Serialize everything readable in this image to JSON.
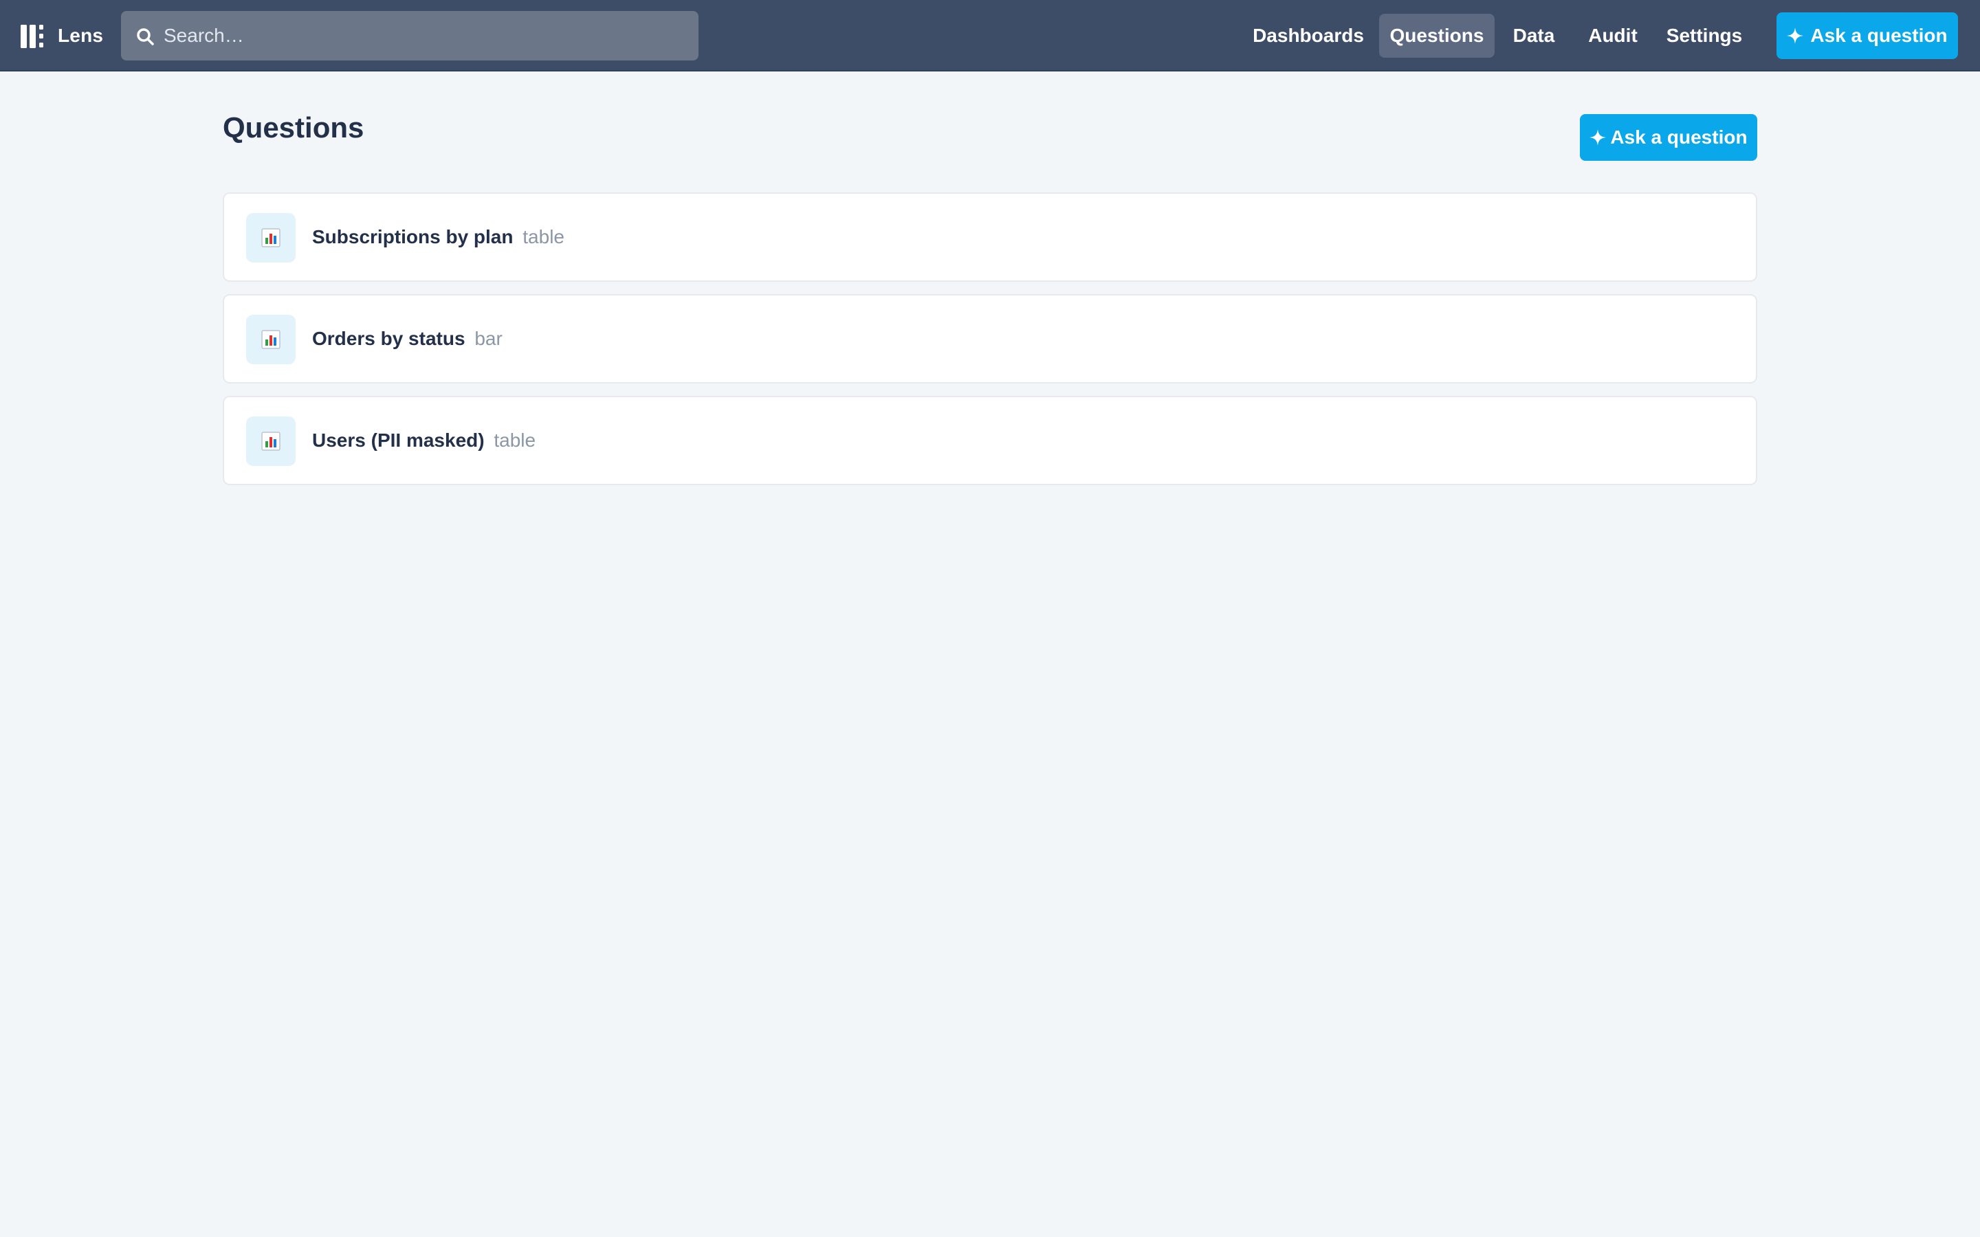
{
  "app": {
    "name": "Lens"
  },
  "search": {
    "placeholder": "Search…",
    "value": ""
  },
  "nav": {
    "items": [
      {
        "label": "Dashboards",
        "active": false
      },
      {
        "label": "Questions",
        "active": true
      },
      {
        "label": "Data",
        "active": false
      },
      {
        "label": "Audit",
        "active": false
      },
      {
        "label": "Settings",
        "active": false
      }
    ],
    "ask_label": "Ask a question"
  },
  "main": {
    "title": "Questions",
    "ask_label": "Ask a question",
    "questions": [
      {
        "title": "Subscriptions by plan",
        "type": "table",
        "icon": "bar-chart-icon"
      },
      {
        "title": "Orders by status",
        "type": "bar",
        "icon": "bar-chart-icon"
      },
      {
        "title": "Users (PII masked)",
        "type": "table",
        "icon": "bar-chart-icon"
      }
    ]
  },
  "colors": {
    "topbar": "#3e4d67",
    "nav_active": "#5c6980",
    "accent": "#0aa7ea",
    "background": "#f3f6f9",
    "title": "#233049",
    "muted": "#8b96a6"
  }
}
